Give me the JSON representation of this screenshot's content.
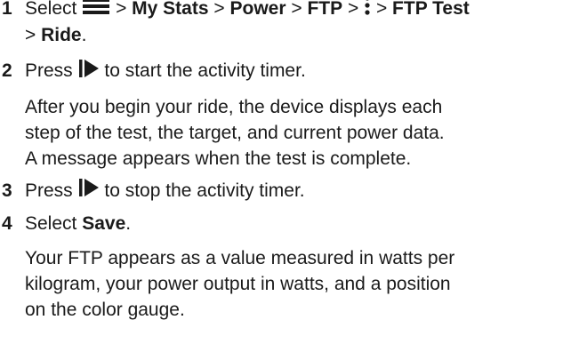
{
  "steps": [
    {
      "number": "1",
      "select_word": "Select",
      "sep": ">",
      "menu_icon": "menu-icon",
      "crumb_my_stats": "My Stats",
      "crumb_power": "Power",
      "crumb_ftp": "FTP",
      "more_icon": "more-vertical-icon",
      "crumb_ftp_test": "FTP Test",
      "crumb_ride": "Ride",
      "period": "."
    },
    {
      "number": "2",
      "press_word": "Press",
      "start_stop_icon": "start-stop-icon",
      "text": "to start the activity timer.",
      "info_lines": [
        "After you begin your ride, the device displays each",
        "step of the test, the target, and current power data.",
        "A message appears when the test is complete."
      ]
    },
    {
      "number": "3",
      "press_word": "Press",
      "start_stop_icon": "start-stop-icon",
      "text": "to stop the activity timer."
    },
    {
      "number": "4",
      "select_word": "Select",
      "save_label": "Save",
      "period": ".",
      "info_lines": [
        "Your FTP appears as a value measured in watts per",
        "kilogram, your power output in watts, and a position",
        "on the color gauge."
      ]
    }
  ]
}
